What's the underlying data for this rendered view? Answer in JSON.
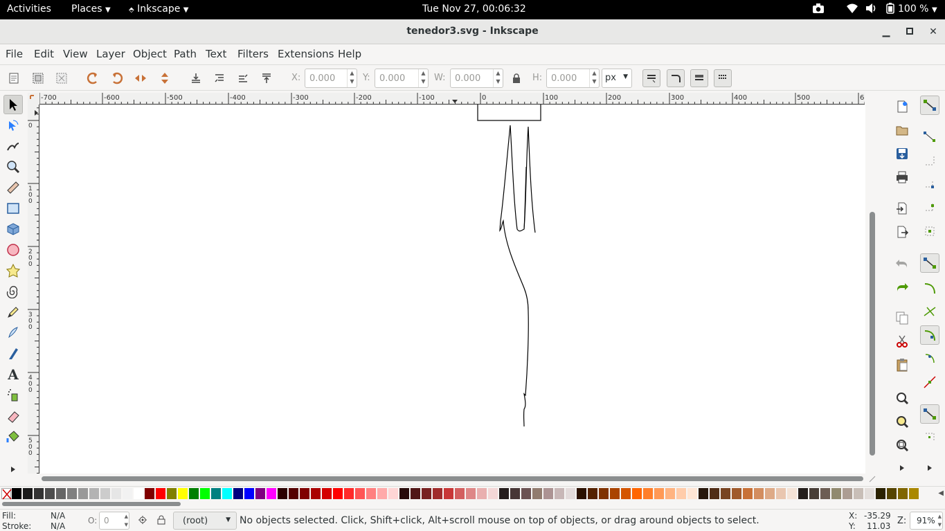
{
  "topbar": {
    "activities": "Activities",
    "places": "Places",
    "app": "Inkscape",
    "clock": "Tue Nov 27, 00:06:32",
    "battery": "100 %"
  },
  "window": {
    "title": "tenedor3.svg - Inkscape"
  },
  "menu": [
    "File",
    "Edit",
    "View",
    "Layer",
    "Object",
    "Path",
    "Text",
    "Filters",
    "Extensions",
    "Help"
  ],
  "toolbar": {
    "x_label": "X:",
    "x_value": "0.000",
    "y_label": "Y:",
    "y_value": "0.000",
    "w_label": "W:",
    "w_value": "0.000",
    "h_label": "H:",
    "h_value": "0.000",
    "unit": "px"
  },
  "rulers": {
    "h_ticks": [
      "-700",
      "-600",
      "-500",
      "-400",
      "-300",
      "-200",
      "-100",
      "0",
      "100",
      "200",
      "300",
      "400",
      "500",
      "60"
    ],
    "v_ticks": [
      "0",
      "1\n0\n0",
      "2\n0\n0",
      "3\n0\n0",
      "4\n0\n0",
      "5\n0\n0"
    ]
  },
  "status": {
    "fill_label": "Fill:",
    "fill_value": "N/A",
    "stroke_label": "Stroke:",
    "stroke_value": "N/A",
    "opacity_label": "O:",
    "opacity_value": "0",
    "layer": "(root)",
    "message": "No objects selected. Click, Shift+click, Alt+scroll mouse on top of objects, or drag around objects to select.",
    "cursor_x_label": "X:",
    "cursor_x": "-35.29",
    "cursor_y_label": "Y:",
    "cursor_y": "11.03",
    "zoom_label": "Z:",
    "zoom_value": "91%"
  },
  "palette_colors": [
    "#000000",
    "#1a1a1a",
    "#333333",
    "#4d4d4d",
    "#666666",
    "#808080",
    "#999999",
    "#b3b3b3",
    "#cccccc",
    "#e6e6e6",
    "#f2f2f2",
    "#ffffff",
    "#800000",
    "#ff0000",
    "#808000",
    "#ffff00",
    "#008000",
    "#00ff00",
    "#008080",
    "#00ffff",
    "#000080",
    "#0000ff",
    "#800080",
    "#ff00ff",
    "#2b0000",
    "#550000",
    "#800000",
    "#aa0000",
    "#d40000",
    "#ff0000",
    "#ff2a2a",
    "#ff5555",
    "#ff8080",
    "#ffaaaa",
    "#ffd5d5",
    "#280b0b",
    "#501616",
    "#782121",
    "#a02c2c",
    "#c83737",
    "#d35f5f",
    "#de8787",
    "#e9afaf",
    "#f4d7d7",
    "#241c1c",
    "#483737",
    "#6c5353",
    "#917c6f",
    "#ac9393",
    "#c8b7b7",
    "#e3dbdb",
    "#2b1100",
    "#552200",
    "#803300",
    "#aa4400",
    "#d45500",
    "#ff6600",
    "#ff7f2a",
    "#ff9955",
    "#ffb380",
    "#ffccaa",
    "#ffe6d5",
    "#28170b",
    "#502d16",
    "#784421",
    "#a05a2c",
    "#c87137",
    "#d38d5f",
    "#deaa87",
    "#e9c6af",
    "#f4e3d7",
    "#241f1c",
    "#483e37",
    "#6c5d53",
    "#918a6f",
    "#ac9d93",
    "#c8beb7",
    "#e3dedb",
    "#2b2200",
    "#554400",
    "#806600",
    "#aa8800"
  ]
}
